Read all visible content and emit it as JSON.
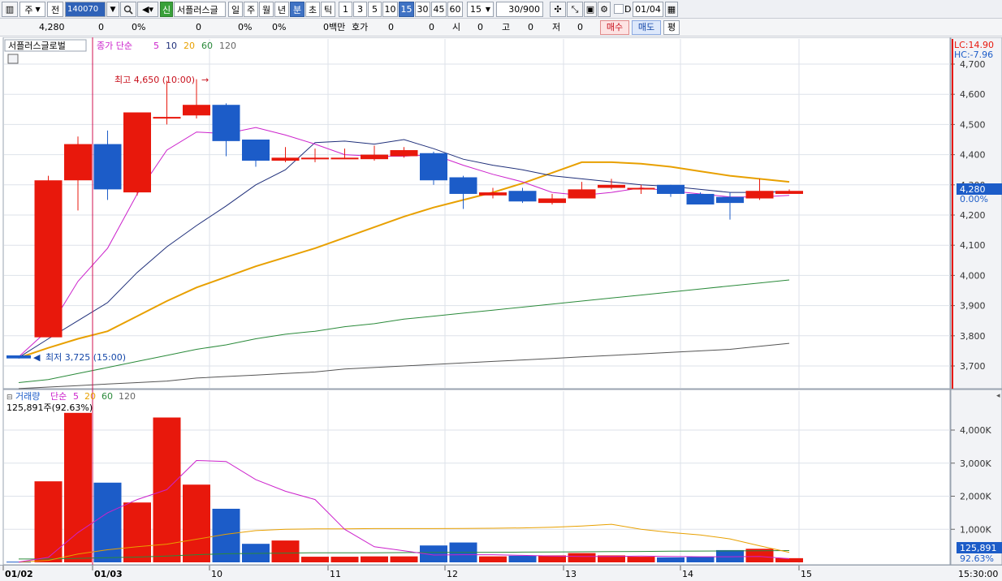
{
  "toolbar": {
    "market_label": "주",
    "prev_label": "전",
    "code": "140070",
    "name": "서플러스글",
    "credit_badge": "신",
    "periods": [
      "일",
      "주",
      "월",
      "년",
      "분",
      "초",
      "틱"
    ],
    "selected_period": "분",
    "intervals": [
      "1",
      "3",
      "5",
      "10",
      "15",
      "30",
      "45",
      "60"
    ],
    "selected_interval": "15",
    "interval_select": "15",
    "count": "30/900",
    "checkbox_label": "D",
    "date": "01/04"
  },
  "quote": {
    "price": "4,280",
    "change": "0",
    "change_pct": "0%",
    "volume": "0",
    "volume_pct": "0%",
    "amount": "0백만",
    "bid_label": "호가",
    "bid": "0",
    "bid2": "0",
    "open_label": "시",
    "open": "0",
    "high_label": "고",
    "high": "0",
    "low_label": "저",
    "low": "0",
    "buy_button": "매수",
    "sell_button": "매도",
    "eval_button": "평"
  },
  "price_pane": {
    "stock_tab": "서플러스글로벌",
    "indicator_label": "종가 단순",
    "ma_periods": [
      "5",
      "10",
      "20",
      "60",
      "120"
    ],
    "ma_colors": [
      "#cc22cc",
      "#1f2f7a",
      "#e8a000",
      "#2a8a3a",
      "#666666"
    ],
    "high_annotation": "최고 4,650 (10:00)",
    "low_annotation": "최저 3,725 (15:00)",
    "lc_label": "LC:14.90",
    "hc_label": "HC:-7.96",
    "current_tag": "4,280",
    "current_pct": "0.00%",
    "y_ticks": [
      "4,700",
      "4,600",
      "4,500",
      "4,400",
      "4,300",
      "4,200",
      "4,100",
      "4,000",
      "3,900",
      "3,800",
      "3,700"
    ]
  },
  "volume_pane": {
    "label": "거래량",
    "indicator_label": "단순",
    "ma_periods": [
      "5",
      "20",
      "60",
      "120"
    ],
    "summary": "125,891주(92.63%)",
    "current_tag": "125,891",
    "current_pct": "92.63%",
    "y_ticks": [
      "4,000K",
      "3,000K",
      "2,000K",
      "1,000K"
    ]
  },
  "time_axis": {
    "labels": [
      "01/02",
      "01/03",
      "10",
      "11",
      "12",
      "13",
      "14",
      "15"
    ],
    "right_label": "15:30:00"
  },
  "colors": {
    "up": "#e8180c",
    "down": "#1c5cc8",
    "grid": "#dde2ea",
    "axis_bg": "#f2f3f6"
  },
  "chart_data": {
    "type": "candlestick",
    "x": [
      "01/02 15:00",
      "01/03 09:00",
      "09:15",
      "09:30",
      "09:45",
      "10:00",
      "10:15",
      "10:30",
      "10:45",
      "11:00",
      "11:15",
      "11:30",
      "11:45",
      "12:00",
      "12:15",
      "12:30",
      "12:45",
      "13:00",
      "13:15",
      "13:30",
      "13:45",
      "14:00",
      "14:15",
      "14:30",
      "14:45",
      "15:00",
      "15:15"
    ],
    "candles": [
      {
        "o": 3735,
        "h": 3735,
        "l": 3725,
        "c": 3725
      },
      {
        "o": 3795,
        "h": 4330,
        "l": 3795,
        "c": 4315
      },
      {
        "o": 4315,
        "h": 4460,
        "l": 4215,
        "c": 4435
      },
      {
        "o": 4435,
        "h": 4480,
        "l": 4250,
        "c": 4285
      },
      {
        "o": 4275,
        "h": 4540,
        "l": 4265,
        "c": 4540
      },
      {
        "o": 4525,
        "h": 4645,
        "l": 4500,
        "c": 4525
      },
      {
        "o": 4530,
        "h": 4650,
        "l": 4520,
        "c": 4565
      },
      {
        "o": 4565,
        "h": 4570,
        "l": 4395,
        "c": 4445
      },
      {
        "o": 4450,
        "h": 4450,
        "l": 4360,
        "c": 4380
      },
      {
        "o": 4380,
        "h": 4425,
        "l": 4375,
        "c": 4390
      },
      {
        "o": 4390,
        "h": 4420,
        "l": 4375,
        "c": 4390
      },
      {
        "o": 4390,
        "h": 4420,
        "l": 4385,
        "c": 4390
      },
      {
        "o": 4385,
        "h": 4430,
        "l": 4380,
        "c": 4400
      },
      {
        "o": 4395,
        "h": 4425,
        "l": 4390,
        "c": 4415
      },
      {
        "o": 4405,
        "h": 4410,
        "l": 4300,
        "c": 4315
      },
      {
        "o": 4325,
        "h": 4330,
        "l": 4220,
        "c": 4270
      },
      {
        "o": 4265,
        "h": 4290,
        "l": 4255,
        "c": 4275
      },
      {
        "o": 4280,
        "h": 4290,
        "l": 4240,
        "c": 4245
      },
      {
        "o": 4240,
        "h": 4270,
        "l": 4235,
        "c": 4255
      },
      {
        "o": 4255,
        "h": 4310,
        "l": 4255,
        "c": 4285
      },
      {
        "o": 4290,
        "h": 4320,
        "l": 4285,
        "c": 4300
      },
      {
        "o": 4290,
        "h": 4300,
        "l": 4270,
        "c": 4290
      },
      {
        "o": 4300,
        "h": 4300,
        "l": 4260,
        "c": 4270
      },
      {
        "o": 4270,
        "h": 4275,
        "l": 4235,
        "c": 4235
      },
      {
        "o": 4260,
        "h": 4275,
        "l": 4185,
        "c": 4240
      },
      {
        "o": 4255,
        "h": 4320,
        "l": 4250,
        "c": 4280
      },
      {
        "o": 4270,
        "h": 4285,
        "l": 4270,
        "c": 4280
      }
    ],
    "ma5": [
      3730,
      3820,
      3980,
      4090,
      4270,
      4415,
      4475,
      4470,
      4490,
      4465,
      4435,
      4400,
      4395,
      4395,
      4400,
      4365,
      4335,
      4310,
      4275,
      4265,
      4275,
      4290,
      4280,
      4270,
      4260,
      4260,
      4265
    ],
    "ma10": [
      3728,
      3790,
      3850,
      3910,
      4010,
      4095,
      4165,
      4230,
      4300,
      4350,
      4440,
      4445,
      4435,
      4450,
      4420,
      4385,
      4365,
      4350,
      4330,
      4320,
      4310,
      4300,
      4295,
      4285,
      4275,
      4275,
      4278
    ],
    "ma20": [
      3727,
      3760,
      3790,
      3815,
      3865,
      3915,
      3960,
      3995,
      4030,
      4060,
      4090,
      4125,
      4160,
      4195,
      4225,
      4250,
      4275,
      4305,
      4340,
      4375,
      4375,
      4370,
      4360,
      4345,
      4330,
      4320,
      4310
    ],
    "ma60": [
      3645,
      3655,
      3675,
      3695,
      3715,
      3735,
      3755,
      3770,
      3790,
      3805,
      3815,
      3830,
      3840,
      3855,
      3865,
      3875,
      3885,
      3895,
      3905,
      3915,
      3925,
      3935,
      3945,
      3955,
      3965,
      3975,
      3985
    ],
    "ma120": [
      3625,
      3630,
      3635,
      3640,
      3645,
      3650,
      3660,
      3665,
      3670,
      3675,
      3680,
      3690,
      3695,
      3700,
      3705,
      3710,
      3715,
      3720,
      3725,
      3730,
      3735,
      3740,
      3745,
      3750,
      3755,
      3765,
      3775
    ],
    "volume": [
      20,
      2450,
      4520,
      2410,
      1810,
      4380,
      2350,
      1620,
      560,
      660,
      170,
      170,
      180,
      180,
      510,
      600,
      180,
      200,
      210,
      280,
      210,
      170,
      150,
      160,
      370,
      410,
      125.891
    ],
    "vol_ma5": [
      10,
      150,
      900,
      1500,
      1900,
      2200,
      3080,
      3050,
      2500,
      2150,
      1900,
      1000,
      470,
      350,
      220,
      230,
      230,
      210,
      190,
      180,
      180,
      190,
      180,
      170,
      170,
      180,
      110
    ],
    "vol_ma20": [
      5,
      60,
      250,
      380,
      470,
      550,
      700,
      850,
      960,
      1000,
      1010,
      1010,
      1020,
      1020,
      1020,
      1025,
      1030,
      1040,
      1060,
      1100,
      1150,
      1000,
      900,
      830,
      710,
      500,
      300
    ],
    "vol_ma60": [
      100,
      100,
      120,
      140,
      160,
      190,
      230,
      260,
      270,
      280,
      290,
      290,
      290,
      295,
      300,
      300,
      305,
      310,
      315,
      320,
      325,
      330,
      335,
      340,
      345,
      350,
      355
    ],
    "ylim": [
      3625,
      4700
    ],
    "vol_ylim": [
      0,
      4500
    ]
  }
}
